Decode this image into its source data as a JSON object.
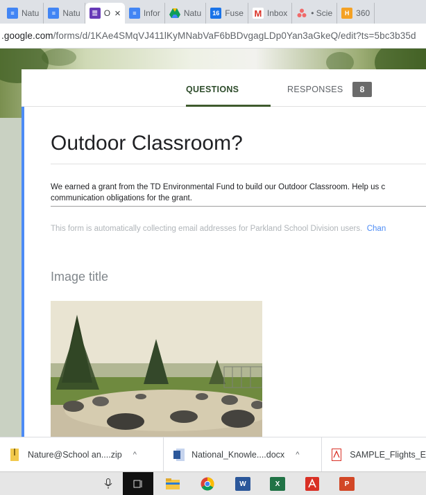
{
  "browser": {
    "tabs": [
      {
        "title": "Natu",
        "icon": "docs-icon",
        "color": "#4285f4"
      },
      {
        "title": "Natu",
        "icon": "docs-icon",
        "color": "#4285f4"
      },
      {
        "title": "O",
        "icon": "forms-icon",
        "color": "#673ab7",
        "active": true
      },
      {
        "title": "Infor",
        "icon": "docs-icon",
        "color": "#4285f4"
      },
      {
        "title": "Natu",
        "icon": "drive-icon",
        "color": "#0f9d58"
      },
      {
        "title": "Fuse",
        "icon": "calendar-icon",
        "color": "#1a73e8",
        "badge": "16"
      },
      {
        "title": "Inbox",
        "icon": "gmail-icon",
        "color": "#d93025",
        "glyph": "M"
      },
      {
        "title": "• Scie",
        "icon": "asana-icon",
        "color": "#f06a6a"
      },
      {
        "title": "360",
        "icon": "h-icon",
        "color": "#f4a124",
        "glyph": "H"
      }
    ],
    "close_glyph": "×",
    "url_host": ".google.com",
    "url_path": "/forms/d/1KAe4SMqVJ411lKyMNabVaF6bBDvgagLDp0Yan3aGkeQ/edit?ts=5bc3b35d"
  },
  "form": {
    "tabs": {
      "questions": "QUESTIONS",
      "responses": "RESPONSES",
      "responses_count": "8"
    },
    "title": "Outdoor Classroom?",
    "description_line1": "We earned a grant from the TD Environmental Fund to build our Outdoor Classroom.  Help us c",
    "description_line2": "communication obligations for the grant.",
    "email_note": "This form is automatically collecting email addresses for Parkland School Division users.",
    "email_note_link": "Chan",
    "image_title": "Image title"
  },
  "downloads": [
    {
      "name": "Nature@School an....zip",
      "icon": "zip-icon",
      "chevron": "^"
    },
    {
      "name": "National_Knowle....docx",
      "icon": "word-icon",
      "chevron": "^"
    },
    {
      "name": "SAMPLE_Flights_E",
      "icon": "pdf-icon",
      "chevron": ""
    }
  ],
  "taskbar": {
    "items": [
      "microphone-icon",
      "task-view-icon",
      "file-explorer-icon",
      "chrome-icon",
      "word-icon",
      "excel-icon",
      "acrobat-icon",
      "powerpoint-icon"
    ],
    "word_glyph": "W",
    "excel_glyph": "X",
    "powerpoint_glyph": "P"
  },
  "colors": {
    "accent": "#4c8bf5",
    "theme": "#3f5a2d",
    "badge": "#6b6b6b"
  }
}
